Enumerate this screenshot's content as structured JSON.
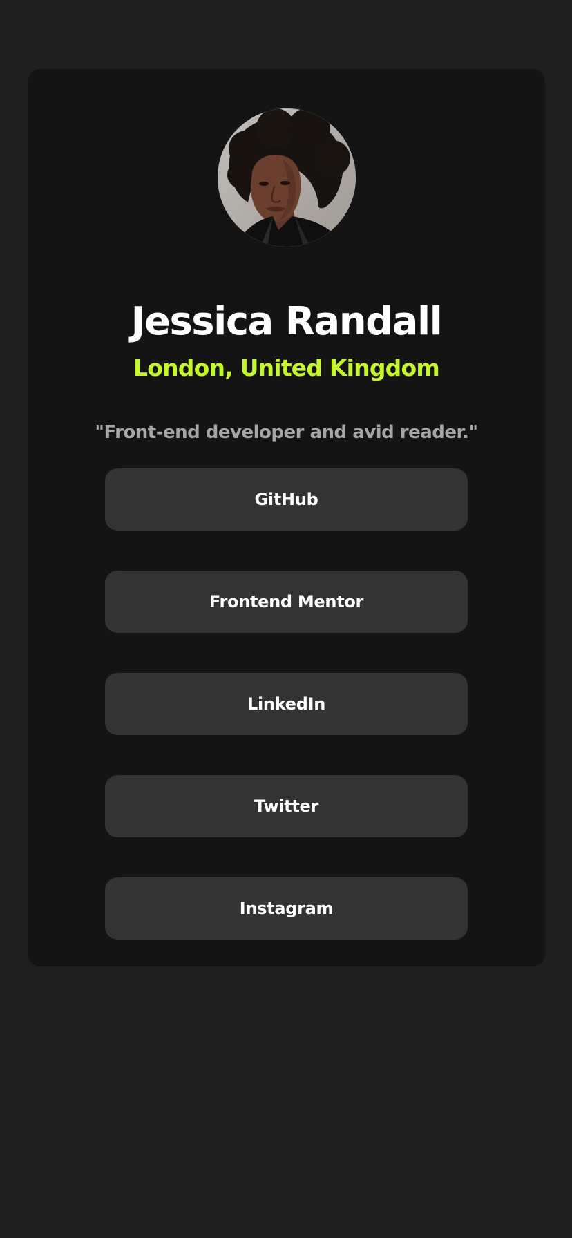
{
  "profile": {
    "name": "Jessica Randall",
    "location": "London, United Kingdom",
    "bio": "\"Front-end developer and avid reader.\"",
    "avatar_icon": "person-portrait-icon"
  },
  "links": [
    {
      "label": "GitHub"
    },
    {
      "label": "Frontend Mentor"
    },
    {
      "label": "LinkedIn"
    },
    {
      "label": "Twitter"
    },
    {
      "label": "Instagram"
    }
  ],
  "colors": {
    "page_background": "#1f1f1f",
    "card_background": "#141414",
    "button_background": "#333333",
    "accent": "#c4f82a",
    "bio_text": "#a6a6a6"
  }
}
